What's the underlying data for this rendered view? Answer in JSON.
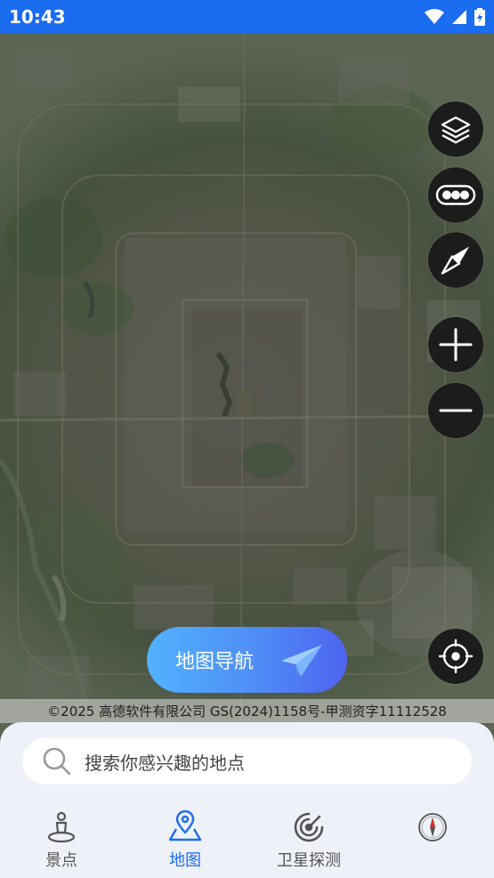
{
  "status_bar": {
    "time": "10:43"
  },
  "map": {
    "controls": [
      {
        "name": "layers-button",
        "icon": "layers-icon"
      },
      {
        "name": "traffic-button",
        "icon": "traffic-icon"
      },
      {
        "name": "compass-button",
        "icon": "compass-icon"
      },
      {
        "name": "zoom-in-button",
        "icon": "plus-icon"
      },
      {
        "name": "zoom-out-button",
        "icon": "minus-icon"
      },
      {
        "name": "locate-button",
        "icon": "crosshair-icon"
      }
    ],
    "nav_button_label": "地图导航",
    "copyright": "©2025 高德软件有限公司 GS(2024)1158号-甲测资字11112528"
  },
  "search": {
    "placeholder": "搜索你感兴趣的地点"
  },
  "tabs": [
    {
      "label": "景点",
      "icon": "person-landmark-icon",
      "active": false
    },
    {
      "label": "地图",
      "icon": "map-pin-icon",
      "active": true
    },
    {
      "label": "卫星探测",
      "icon": "radar-icon",
      "active": false
    },
    {
      "label": "",
      "icon": "compass-tab-icon",
      "active": false
    }
  ],
  "colors": {
    "accent": "#1a6cf0",
    "status_bar": "#1a6cf0",
    "control_bg": "#1c1c1c",
    "sheet_bg": "#eef1f8"
  }
}
